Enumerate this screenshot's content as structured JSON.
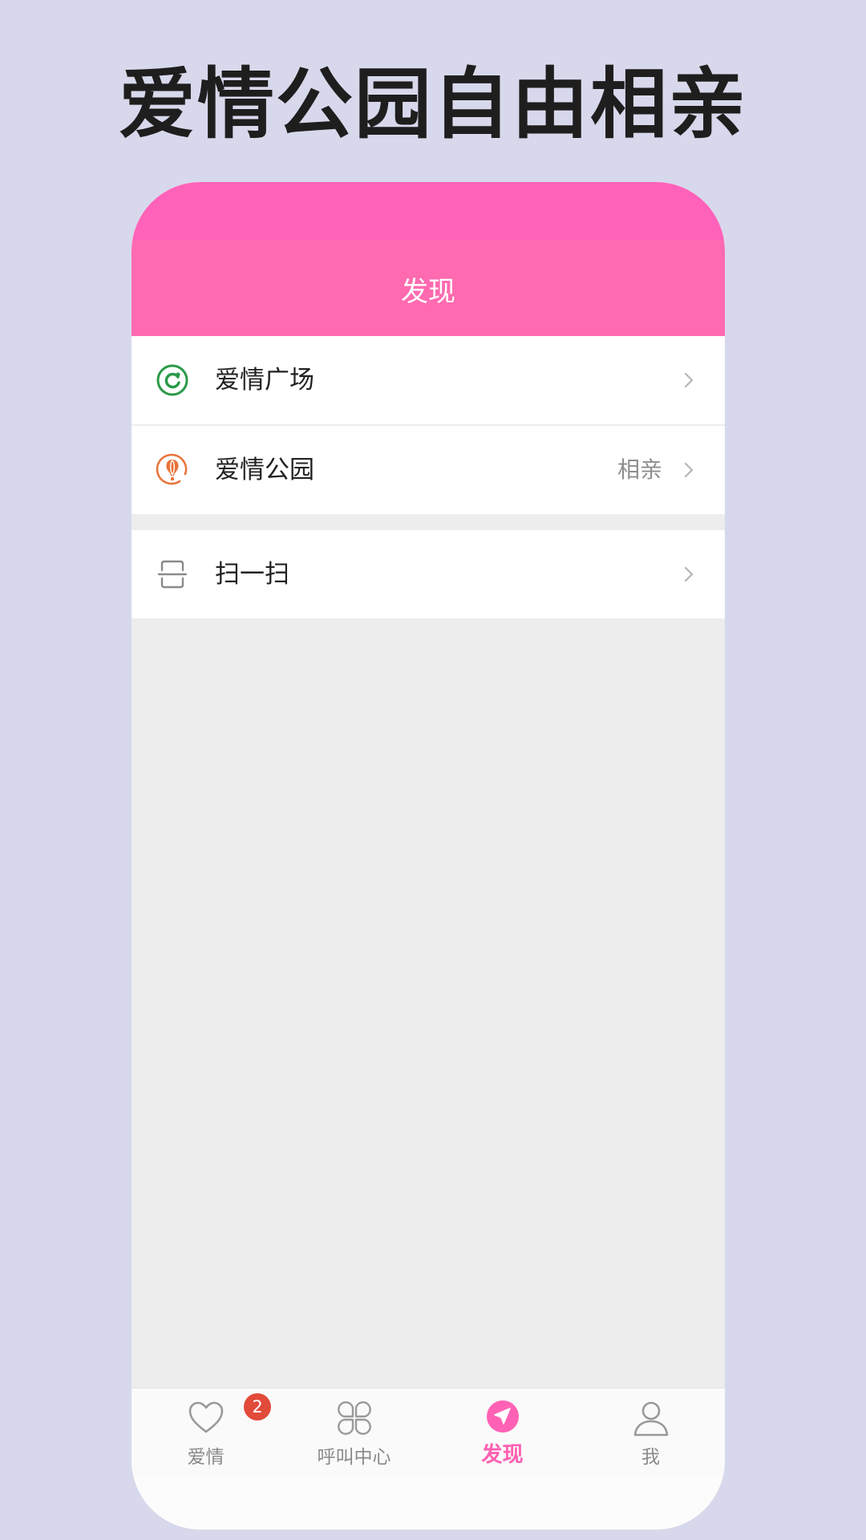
{
  "promo": {
    "headline": "爱情公园自由相亲"
  },
  "navbar": {
    "title": "发现"
  },
  "menu": {
    "items": [
      {
        "label": "爱情广场",
        "tag": "",
        "icon": "refresh-circle-icon",
        "icon_color": "#2a9a48"
      },
      {
        "label": "爱情公园",
        "tag": "相亲",
        "icon": "hot-air-balloon-icon",
        "icon_color": "#e8743a"
      },
      {
        "label": "扫一扫",
        "tag": "",
        "icon": "scan-icon",
        "icon_color": "#8a8a8a"
      }
    ]
  },
  "tabbar": {
    "tabs": [
      {
        "label": "爱情",
        "icon": "heart-icon",
        "badge": "2"
      },
      {
        "label": "呼叫中心",
        "icon": "grid-petals-icon",
        "badge": ""
      },
      {
        "label": "发现",
        "icon": "compass-send-icon",
        "badge": ""
      },
      {
        "label": "我",
        "icon": "user-icon",
        "badge": ""
      }
    ],
    "active_color": "#ff5fb0"
  },
  "theme": {
    "brand_pink": "#ff6ab0",
    "background": "#d8d8ec"
  }
}
